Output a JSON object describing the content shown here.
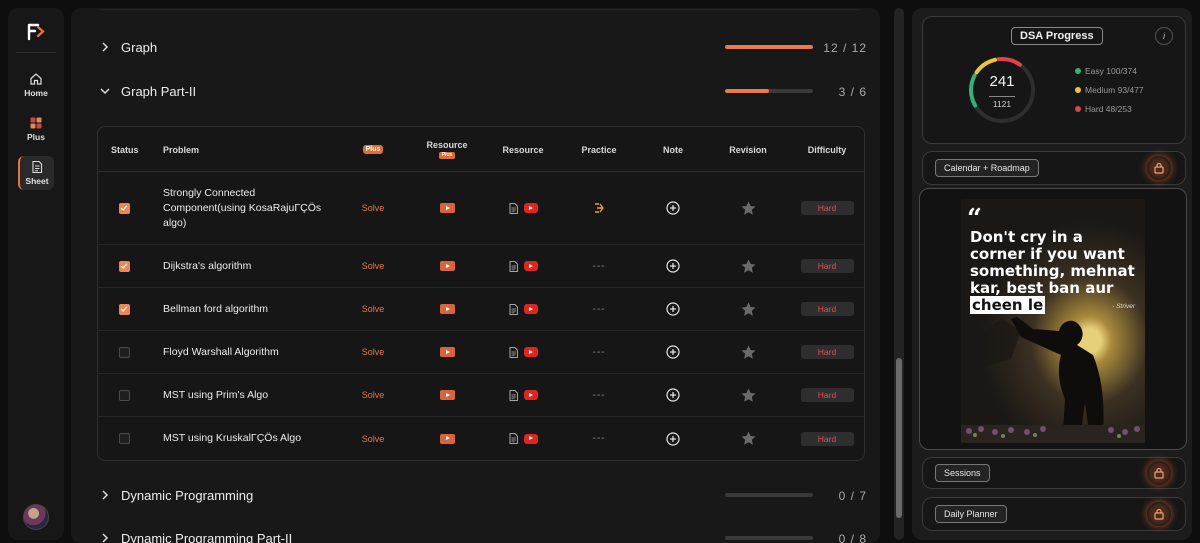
{
  "nav": {
    "items": [
      {
        "label": "Home",
        "icon": "home-icon"
      },
      {
        "label": "Plus",
        "icon": "plus-grid-icon"
      },
      {
        "label": "Sheet",
        "icon": "sheet-icon"
      }
    ],
    "active": "Sheet"
  },
  "topics": [
    {
      "name": "Graph",
      "count": "12 / 12",
      "progress": 1.0,
      "expanded": false
    },
    {
      "name": "Graph Part-II",
      "count": "3 / 6",
      "progress": 0.5,
      "expanded": true
    },
    {
      "name": "Dynamic Programming",
      "count": "0 / 7",
      "progress": 0.0,
      "expanded": false
    },
    {
      "name": "Dynamic Programming Part-II",
      "count": "0 / 8",
      "progress": 0.0,
      "expanded": false
    }
  ],
  "table": {
    "headers": {
      "status": "Status",
      "problem": "Problem",
      "plus": "Plus",
      "resource_plus": "Resource",
      "resource_plus_badge": "Plus",
      "resource": "Resource",
      "practice": "Practice",
      "note": "Note",
      "revision": "Revision",
      "difficulty": "Difficulty"
    },
    "rows": [
      {
        "done": true,
        "problem": "Strongly Connected Component(using KosaRajuΓÇÖs algo)",
        "solve": "Solve",
        "practice": "",
        "difficulty": "Hard"
      },
      {
        "done": true,
        "problem": "Dijkstra's algorithm",
        "solve": "Solve",
        "practice": "---",
        "difficulty": "Hard"
      },
      {
        "done": true,
        "problem": "Bellman ford algorithm",
        "solve": "Solve",
        "practice": "---",
        "difficulty": "Hard"
      },
      {
        "done": false,
        "problem": "Floyd Warshall Algorithm",
        "solve": "Solve",
        "practice": "---",
        "difficulty": "Hard"
      },
      {
        "done": false,
        "problem": "MST using Prim's Algo",
        "solve": "Solve",
        "practice": "---",
        "difficulty": "Hard"
      },
      {
        "done": false,
        "problem": "MST using KruskalΓÇÖs Algo",
        "solve": "Solve",
        "practice": "---",
        "difficulty": "Hard"
      }
    ]
  },
  "progress": {
    "title": "DSA Progress",
    "info": "i",
    "solved": "241",
    "total": "1121",
    "easy": "Easy 100/374",
    "medium": "Medium 93/477",
    "hard": "Hard 48/253",
    "easy_fraction": 0.267,
    "medium_fraction": 0.195,
    "hard_fraction": 0.19
  },
  "cards": {
    "calendar": "Calendar + Roadmap",
    "sessions": "Sessions",
    "planner": "Daily Planner"
  },
  "quote": {
    "mark": "“",
    "text": "Don't cry in a corner if you want something, mehnat kar, best ban aur",
    "highlight": "cheen le",
    "author": "- Striver"
  },
  "colors": {
    "accent": "#ea7a46",
    "easy": "#2fb37a",
    "medium": "#e8c63a",
    "hard": "#e2404a"
  }
}
